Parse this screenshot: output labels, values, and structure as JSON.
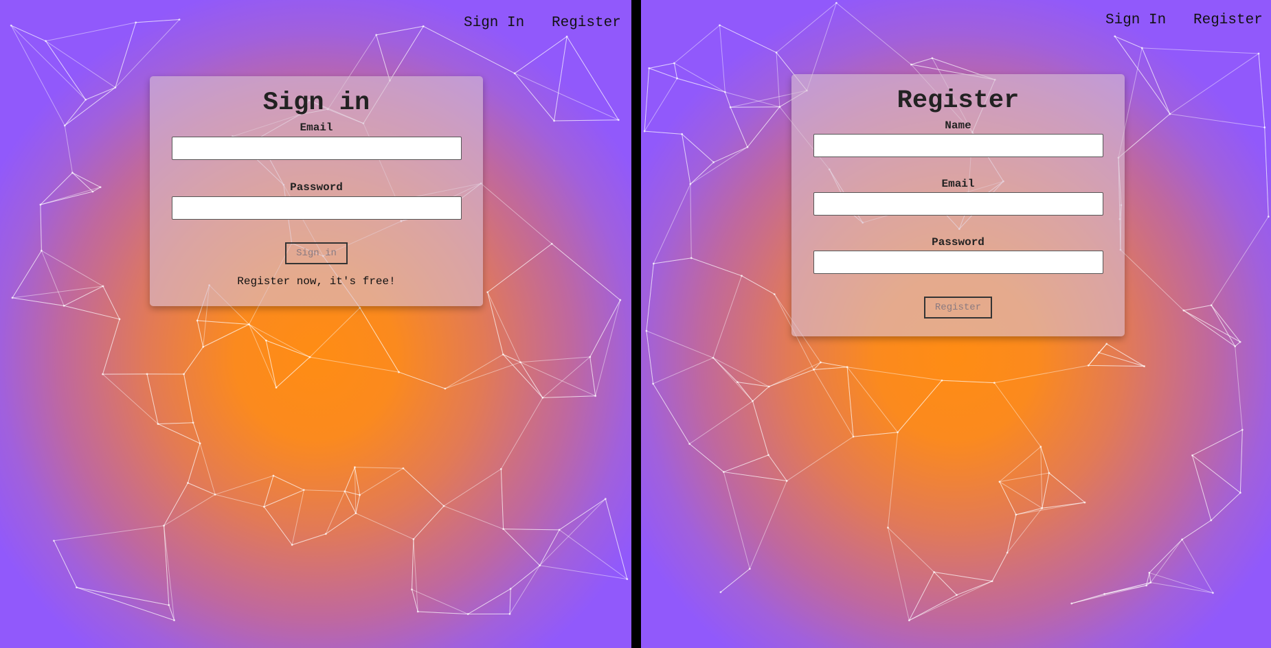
{
  "left": {
    "nav": {
      "signin": "Sign In",
      "register": "Register"
    },
    "form": {
      "title": "Sign in",
      "email_label": "Email",
      "email_value": "",
      "password_label": "Password",
      "password_value": "",
      "submit_label": "Sign in",
      "register_link": "Register now, it's free!"
    }
  },
  "right": {
    "nav": {
      "signin": "Sign In",
      "register": "Register"
    },
    "form": {
      "title": "Register",
      "name_label": "Name",
      "name_value": "",
      "email_label": "Email",
      "email_value": "",
      "password_label": "Password",
      "password_value": "",
      "submit_label": "Register"
    }
  },
  "colors": {
    "gradient_center": "#ff8c14",
    "gradient_edge": "#9159fb",
    "divider": "#000000",
    "line": "#ffffff"
  }
}
